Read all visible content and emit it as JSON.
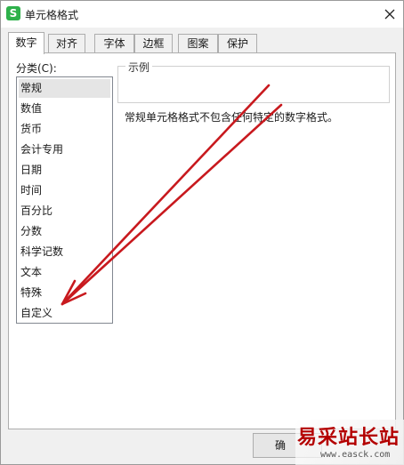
{
  "window": {
    "title": "单元格格式",
    "app_icon": "S"
  },
  "tabs": [
    {
      "label": "数字",
      "active": true
    },
    {
      "label": "对齐",
      "active": false
    },
    {
      "label": "字体",
      "active": false
    },
    {
      "label": "边框",
      "active": false
    },
    {
      "label": "图案",
      "active": false
    },
    {
      "label": "保护",
      "active": false
    }
  ],
  "category": {
    "label": "分类(C):",
    "items": [
      "常规",
      "数值",
      "货币",
      "会计专用",
      "日期",
      "时间",
      "百分比",
      "分数",
      "科学记数",
      "文本",
      "特殊",
      "自定义"
    ],
    "selected": "常规"
  },
  "sample": {
    "label": "示例",
    "value": ""
  },
  "description": "常规单元格格式不包含任何特定的数字格式。",
  "buttons": {
    "ok": "确"
  },
  "annotation": {
    "color": "#c8191e",
    "icon": "arrow"
  },
  "watermark": {
    "logo_text": "易采站长站",
    "url": "www.easck.com"
  },
  "colors": {
    "accent": "#2eb14b",
    "selection": "#e5e5e5"
  }
}
